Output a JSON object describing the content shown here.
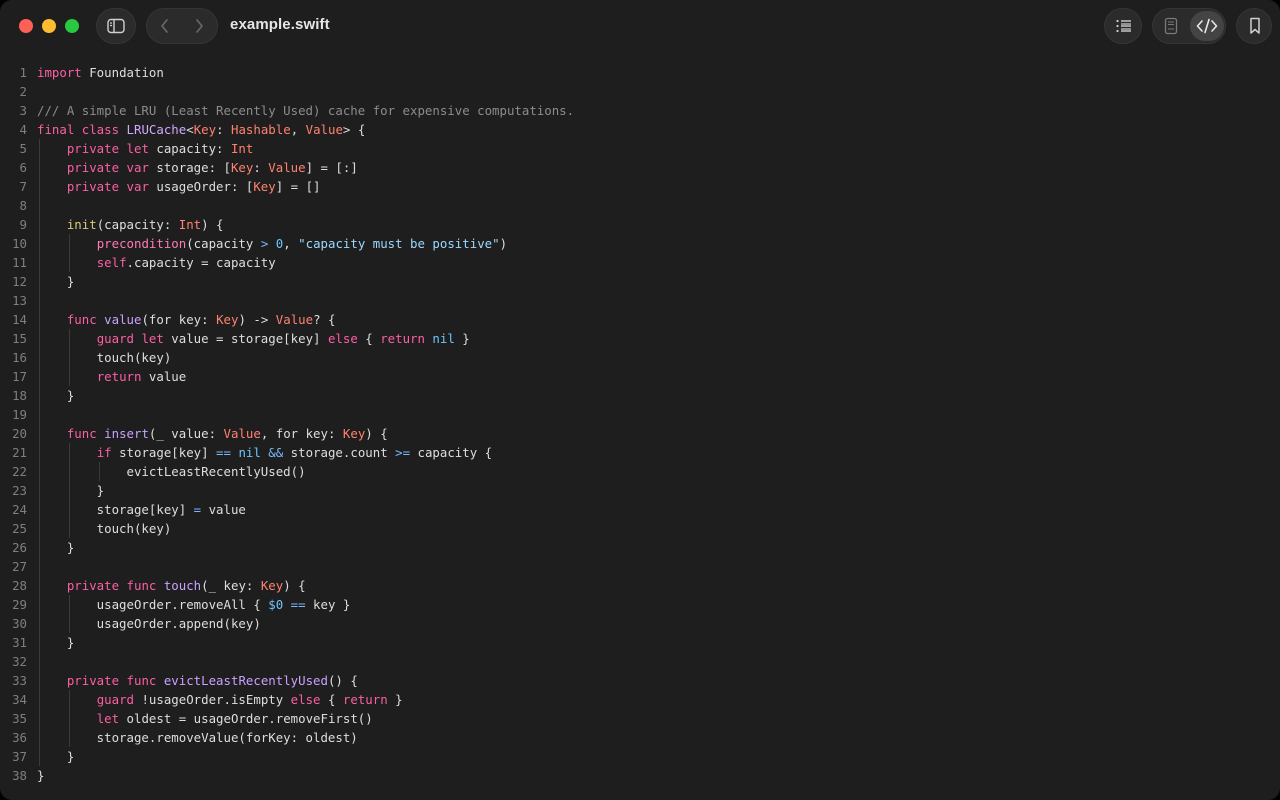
{
  "window": {
    "title": "example.swift",
    "colors": {
      "close": "#fe5f57",
      "minimize": "#febc2e",
      "zoom": "#28c840",
      "background": "#1e1e1e"
    }
  },
  "toolbar": {
    "left": [
      {
        "name": "sidebar-toggle-button",
        "icon": "sidebar-icon"
      },
      {
        "name": "back-button",
        "icon": "chevron-left-icon"
      },
      {
        "name": "forward-button",
        "icon": "chevron-right-icon"
      }
    ],
    "right": [
      {
        "name": "outline-button",
        "icon": "list-icon"
      },
      {
        "name": "preview-button",
        "icon": "document-icon"
      },
      {
        "name": "code-view-button",
        "icon": "code-brackets-icon",
        "active": true
      },
      {
        "name": "bookmark-button",
        "icon": "bookmark-icon"
      }
    ]
  },
  "editor": {
    "language": "swift",
    "lines": [
      [
        [
          "kw",
          "import"
        ],
        [
          "plain",
          " Foundation"
        ]
      ],
      [],
      [
        [
          "comment",
          "/// A simple LRU (Least Recently Used) cache for expensive computations."
        ]
      ],
      [
        [
          "kw",
          "final class"
        ],
        [
          "plain",
          " "
        ],
        [
          "func",
          "LRUCache"
        ],
        [
          "plain",
          "<"
        ],
        [
          "type",
          "Key"
        ],
        [
          "plain",
          ": "
        ],
        [
          "type",
          "Hashable"
        ],
        [
          "plain",
          ", "
        ],
        [
          "type",
          "Value"
        ],
        [
          "plain",
          "> {"
        ]
      ],
      [
        [
          "plain",
          "    "
        ],
        [
          "kw",
          "private let"
        ],
        [
          "plain",
          " capacity: "
        ],
        [
          "type",
          "Int"
        ]
      ],
      [
        [
          "plain",
          "    "
        ],
        [
          "kw",
          "private var"
        ],
        [
          "plain",
          " storage: ["
        ],
        [
          "type",
          "Key"
        ],
        [
          "plain",
          ": "
        ],
        [
          "type",
          "Value"
        ],
        [
          "plain",
          "] = [:]"
        ]
      ],
      [
        [
          "plain",
          "    "
        ],
        [
          "kw",
          "private var"
        ],
        [
          "plain",
          " usageOrder: ["
        ],
        [
          "type",
          "Key"
        ],
        [
          "plain",
          "] = []"
        ]
      ],
      [],
      [
        [
          "plain",
          "    "
        ],
        [
          "decl",
          "init"
        ],
        [
          "plain",
          "(capacity: "
        ],
        [
          "type",
          "Int"
        ],
        [
          "plain",
          ") {"
        ]
      ],
      [
        [
          "plain",
          "        "
        ],
        [
          "builtin",
          "precondition"
        ],
        [
          "plain",
          "(capacity "
        ],
        [
          "op",
          ">"
        ],
        [
          "plain",
          " "
        ],
        [
          "num",
          "0"
        ],
        [
          "plain",
          ", "
        ],
        [
          "str",
          "\"capacity must be positive\""
        ],
        [
          "plain",
          ")"
        ]
      ],
      [
        [
          "plain",
          "        "
        ],
        [
          "kw",
          "self"
        ],
        [
          "plain",
          ".capacity = capacity"
        ]
      ],
      [
        [
          "plain",
          "    }"
        ]
      ],
      [],
      [
        [
          "plain",
          "    "
        ],
        [
          "kw",
          "func"
        ],
        [
          "plain",
          " "
        ],
        [
          "fnname",
          "value"
        ],
        [
          "plain",
          "(for key: "
        ],
        [
          "type",
          "Key"
        ],
        [
          "plain",
          ") -> "
        ],
        [
          "type",
          "Value"
        ],
        [
          "plain",
          "? {"
        ]
      ],
      [
        [
          "plain",
          "        "
        ],
        [
          "kw",
          "guard let"
        ],
        [
          "plain",
          " value = storage[key] "
        ],
        [
          "kw",
          "else"
        ],
        [
          "plain",
          " { "
        ],
        [
          "kw",
          "return"
        ],
        [
          "plain",
          " "
        ],
        [
          "num",
          "nil"
        ],
        [
          "plain",
          " }"
        ]
      ],
      [
        [
          "plain",
          "        touch(key)"
        ]
      ],
      [
        [
          "plain",
          "        "
        ],
        [
          "kw",
          "return"
        ],
        [
          "plain",
          " value"
        ]
      ],
      [
        [
          "plain",
          "    }"
        ]
      ],
      [],
      [
        [
          "plain",
          "    "
        ],
        [
          "kw",
          "func"
        ],
        [
          "plain",
          " "
        ],
        [
          "fnname",
          "insert"
        ],
        [
          "plain",
          "(_ value: "
        ],
        [
          "type",
          "Value"
        ],
        [
          "plain",
          ", for key: "
        ],
        [
          "type",
          "Key"
        ],
        [
          "plain",
          ") {"
        ]
      ],
      [
        [
          "plain",
          "        "
        ],
        [
          "kw",
          "if"
        ],
        [
          "plain",
          " storage[key] "
        ],
        [
          "op",
          "=="
        ],
        [
          "plain",
          " "
        ],
        [
          "num",
          "nil"
        ],
        [
          "plain",
          " "
        ],
        [
          "op",
          "&&"
        ],
        [
          "plain",
          " storage.count "
        ],
        [
          "op",
          ">="
        ],
        [
          "plain",
          " capacity {"
        ]
      ],
      [
        [
          "plain",
          "            evictLeastRecentlyUsed()"
        ]
      ],
      [
        [
          "plain",
          "        }"
        ]
      ],
      [
        [
          "plain",
          "        storage[key] "
        ],
        [
          "op",
          "="
        ],
        [
          "plain",
          " value"
        ]
      ],
      [
        [
          "plain",
          "        touch(key)"
        ]
      ],
      [
        [
          "plain",
          "    }"
        ]
      ],
      [],
      [
        [
          "plain",
          "    "
        ],
        [
          "kw",
          "private func"
        ],
        [
          "plain",
          " "
        ],
        [
          "fnname",
          "touch"
        ],
        [
          "plain",
          "(_ key: "
        ],
        [
          "type",
          "Key"
        ],
        [
          "plain",
          ") {"
        ]
      ],
      [
        [
          "plain",
          "        usageOrder.removeAll { "
        ],
        [
          "num",
          "$0"
        ],
        [
          "plain",
          " "
        ],
        [
          "op",
          "=="
        ],
        [
          "plain",
          " key }"
        ]
      ],
      [
        [
          "plain",
          "        usageOrder.append(key)"
        ]
      ],
      [
        [
          "plain",
          "    }"
        ]
      ],
      [],
      [
        [
          "plain",
          "    "
        ],
        [
          "kw",
          "private func"
        ],
        [
          "plain",
          " "
        ],
        [
          "fnname",
          "evictLeastRecentlyUsed"
        ],
        [
          "plain",
          "() {"
        ]
      ],
      [
        [
          "plain",
          "        "
        ],
        [
          "kw",
          "guard"
        ],
        [
          "plain",
          " !usageOrder.isEmpty "
        ],
        [
          "kw",
          "else"
        ],
        [
          "plain",
          " { "
        ],
        [
          "kw",
          "return"
        ],
        [
          "plain",
          " }"
        ]
      ],
      [
        [
          "plain",
          "        "
        ],
        [
          "kw",
          "let"
        ],
        [
          "plain",
          " oldest = usageOrder.removeFirst()"
        ]
      ],
      [
        [
          "plain",
          "        storage.removeValue(forKey: oldest)"
        ]
      ],
      [
        [
          "plain",
          "    }"
        ]
      ],
      [
        [
          "plain",
          "}"
        ]
      ]
    ]
  }
}
